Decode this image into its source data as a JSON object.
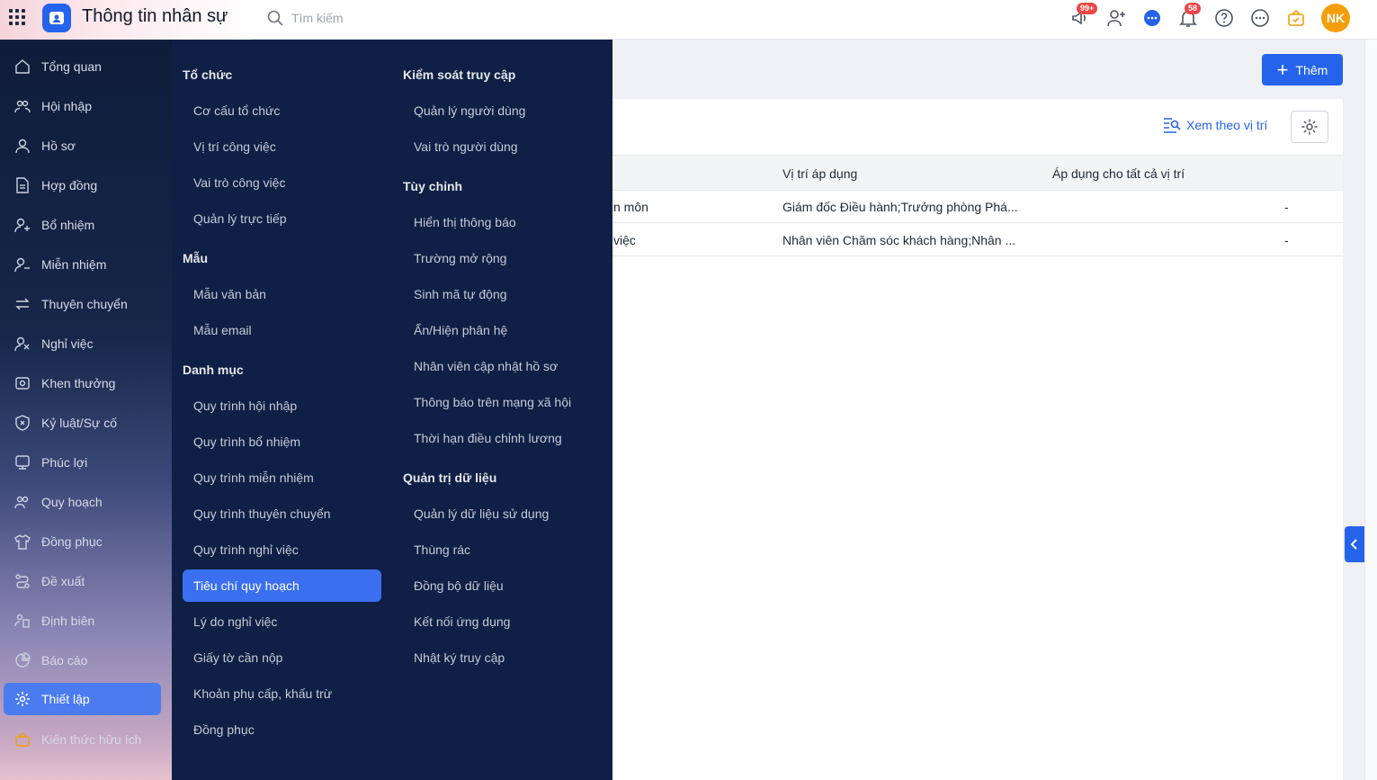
{
  "header": {
    "app_title": "Thông tin nhân sự",
    "search_placeholder": "Tìm kiếm",
    "badges": {
      "announcements": "99+",
      "notifications": "58"
    },
    "avatar_initials": "NK"
  },
  "sidebar": {
    "items": [
      {
        "label": "Tổng quan",
        "icon": "home-icon"
      },
      {
        "label": "Hội nhập",
        "icon": "users-icon"
      },
      {
        "label": "Hồ sơ",
        "icon": "user-icon"
      },
      {
        "label": "Hợp đồng",
        "icon": "document-icon"
      },
      {
        "label": "Bổ nhiệm",
        "icon": "user-plus-icon"
      },
      {
        "label": "Miễn nhiệm",
        "icon": "user-minus-icon"
      },
      {
        "label": "Thuyên chuyển",
        "icon": "transfer-icon"
      },
      {
        "label": "Nghỉ việc",
        "icon": "user-x-icon"
      },
      {
        "label": "Khen thưởng",
        "icon": "award-icon"
      },
      {
        "label": "Kỷ luật/Sự cố",
        "icon": "shield-icon"
      },
      {
        "label": "Phúc lợi",
        "icon": "benefit-icon"
      },
      {
        "label": "Quy hoạch",
        "icon": "planning-icon"
      },
      {
        "label": "Đồng phục",
        "icon": "shirt-icon"
      },
      {
        "label": "Đề xuất",
        "icon": "proposal-icon"
      },
      {
        "label": "Định biên",
        "icon": "staffing-icon"
      },
      {
        "label": "Báo cáo",
        "icon": "chart-icon"
      },
      {
        "label": "Thiết lập",
        "icon": "gear-icon",
        "active": true
      },
      {
        "label": "Kiến thức hữu ích",
        "icon": "knowledge-icon"
      }
    ]
  },
  "mega_menu": {
    "col1": {
      "to_chuc": {
        "title": "Tổ chức",
        "items": [
          "Cơ cấu tổ chức",
          "Vị trí công việc",
          "Vai trò công việc",
          "Quản lý trực tiếp"
        ]
      },
      "mau": {
        "title": "Mẫu",
        "items": [
          "Mẫu văn bản",
          "Mẫu email"
        ]
      },
      "danh_muc": {
        "title": "Danh mục",
        "items": [
          "Quy trình hội nhập",
          "Quy trình bổ nhiệm",
          "Quy trình miễn nhiệm",
          "Quy trình thuyên chuyển",
          "Quy trình nghỉ việc",
          "Tiêu chí quy hoạch",
          "Lý do nghỉ việc",
          "Giấy tờ cần nộp",
          "Khoản phụ cấp, khấu trừ",
          "Đồng phục"
        ],
        "active_index": 5
      }
    },
    "col2": {
      "kiem_soat": {
        "title": "Kiểm soát truy cập",
        "items": [
          "Quản lý người dùng",
          "Vai trò người dùng"
        ]
      },
      "tuy_chinh": {
        "title": "Tùy chỉnh",
        "items": [
          "Hiển thị thông báo",
          "Trường mở rộng",
          "Sinh mã tự động",
          "Ẩn/Hiện phân hệ",
          "Nhân viên cập nhật hồ sơ",
          "Thông báo trên mạng xã hội",
          "Thời hạn điều chỉnh lương"
        ]
      },
      "quan_tri": {
        "title": "Quản trị dữ liệu",
        "items": [
          "Quản lý dữ liệu sử dụng",
          "Thùng rác",
          "Đồng bộ dữ liệu",
          "Kết nối ứng dụng",
          "Nhật ký truy cập"
        ]
      }
    }
  },
  "main": {
    "add_button": "Thêm",
    "view_by_position": "Xem theo vị trí",
    "table": {
      "headers": [
        "Vị trí áp dụng",
        "Áp dụng cho tất cả vị trí"
      ],
      "rows": [
        {
          "partial": "n môn",
          "positions": "Giám đốc Điều hành;Trưởng phòng Phá...",
          "all": "-"
        },
        {
          "partial": "việc",
          "positions": "Nhân viên Chăm sóc khách hàng;Nhân ...",
          "all": "-"
        }
      ]
    }
  },
  "colors": {
    "primary": "#2563eb",
    "menu_bg": "#0f1f45",
    "active_item": "#3b6ff0"
  }
}
